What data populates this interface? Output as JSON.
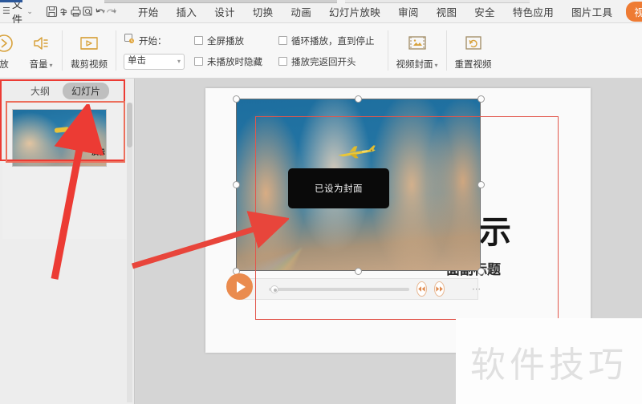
{
  "app": {
    "menu_hamburger": "☰",
    "file_menu": "文件",
    "file_caret": "⌄",
    "quick_access": [
      {
        "name": "save-icon",
        "title": "保存"
      },
      {
        "name": "cloud-save-icon",
        "title": "上传"
      },
      {
        "name": "print-icon",
        "title": "打印"
      },
      {
        "name": "print-preview-icon",
        "title": "打印预览"
      },
      {
        "name": "undo-icon",
        "title": "撤销"
      },
      {
        "name": "redo-icon",
        "title": "恢复"
      },
      {
        "name": "customize-caret-icon",
        "title": "自定义"
      }
    ],
    "tabs": [
      {
        "label": "开始",
        "active": false
      },
      {
        "label": "插入",
        "active": false
      },
      {
        "label": "设计",
        "active": false
      },
      {
        "label": "切换",
        "active": false
      },
      {
        "label": "动画",
        "active": false
      },
      {
        "label": "幻灯片放映",
        "active": false
      },
      {
        "label": "审阅",
        "active": false
      },
      {
        "label": "视图",
        "active": false
      },
      {
        "label": "安全",
        "active": false
      },
      {
        "label": "特色应用",
        "active": false
      },
      {
        "label": "图片工具",
        "active": false
      },
      {
        "label": "视频工具",
        "active": true
      }
    ],
    "accent_color": "#ee7b33"
  },
  "ribbon": {
    "play_button": {
      "label": "放",
      "icon": "play-circle-icon"
    },
    "volume_button": {
      "label": "音量",
      "caret": "▾",
      "icon": "speaker-icon"
    },
    "trim_button": {
      "label": "裁剪视频",
      "icon": "film-trim-icon"
    },
    "start_label": "开始：",
    "start_icon": "start-clock-icon",
    "start_value": "单击",
    "start_caret": "▾",
    "checkboxes": [
      {
        "label": "全屏播放",
        "checked": false
      },
      {
        "label": "未播放时隐藏",
        "checked": false
      },
      {
        "label": "循环播放，直到停止",
        "checked": false
      },
      {
        "label": "播放完返回开头",
        "checked": false
      }
    ],
    "cover_button": {
      "label": "视频封面",
      "caret": "▾",
      "icon": "video-cover-icon"
    },
    "reset_button": {
      "label": "重置视频",
      "icon": "reset-video-icon"
    }
  },
  "left_panel": {
    "tabs": [
      {
        "label": "大纲",
        "selected": false
      },
      {
        "label": "幻灯片",
        "selected": true
      }
    ],
    "thumbnail": {
      "overlay_text": "演示"
    }
  },
  "slide": {
    "title": "演示",
    "subtitle": "面副标题",
    "video": {
      "tooltip": "已设为封面",
      "controls": {
        "play": "▶",
        "rewind": "⏪",
        "forward": "⏩",
        "more": "⋯",
        "progress_percent": 2
      }
    }
  },
  "watermark": {
    "text": "软件技巧"
  }
}
